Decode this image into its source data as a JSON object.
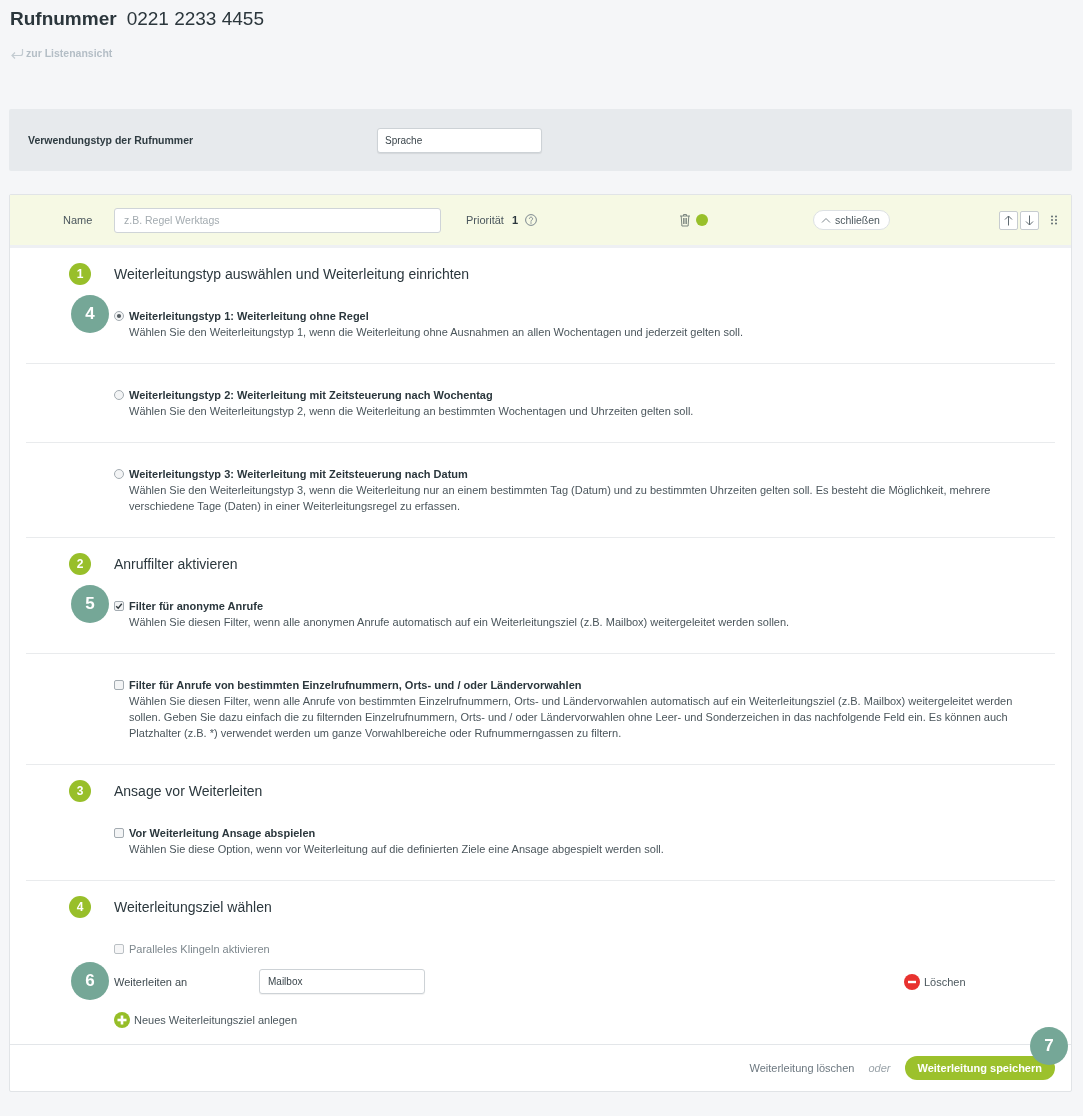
{
  "header": {
    "title": "Rufnummer",
    "number": "0221 2233 4455",
    "back_link": "zur Listenansicht"
  },
  "usage_type": {
    "label": "Verwendungstyp der Rufnummer",
    "value": "Sprache"
  },
  "rule": {
    "name_label": "Name",
    "name_placeholder": "z.B. Regel Werktags",
    "priority_label": "Priorität",
    "priority": "1",
    "active": true,
    "collapse_button": "schließen",
    "sections": [
      {
        "kind": "options",
        "step": "1",
        "title": "Weiterleitungstyp auswählen und Weiterleitung einrichten",
        "options": [
          {
            "kind": "radio",
            "selected": true,
            "title": "Weiterleitungstyp 1: Weiterleitung ohne Regel",
            "description": "Wählen Sie den Weiterleitungstyp 1, wenn die Weiterleitung ohne Ausnahmen an allen Wochentagen und jederzeit gelten soll.",
            "callout": "4"
          },
          {
            "kind": "radio",
            "selected": false,
            "title": "Weiterleitungstyp 2: Weiterleitung mit Zeitsteuerung nach Wochentag",
            "description": "Wählen Sie den Weiterleitungstyp 2, wenn die Weiterleitung an bestimmten Wochentagen und Uhrzeiten gelten soll."
          },
          {
            "kind": "radio",
            "selected": false,
            "title": "Weiterleitungstyp 3: Weiterleitung mit Zeitsteuerung nach Datum",
            "description": "Wählen Sie den Weiterleitungstyp 3, wenn die Weiterleitung nur an einem bestimmten Tag (Datum) und zu bestimmten Uhrzeiten gelten soll. Es besteht die Möglichkeit, mehrere verschiedene Tage (Daten) in einer Weiterleitungsregel zu erfassen."
          }
        ]
      },
      {
        "kind": "options",
        "step": "2",
        "title": "Anruffilter aktivieren",
        "options": [
          {
            "kind": "checkbox",
            "checked": true,
            "title": "Filter für anonyme Anrufe",
            "description": "Wählen Sie diesen Filter, wenn alle anonymen Anrufe automatisch auf ein Weiterleitungsziel (z.B. Mailbox) weitergeleitet werden sollen.",
            "callout": "5"
          },
          {
            "kind": "checkbox",
            "checked": false,
            "title": "Filter für Anrufe von bestimmten Einzelrufnummern, Orts- und / oder Ländervorwahlen",
            "description": "Wählen Sie diesen Filter, wenn alle Anrufe von bestimmten Einzelrufnummern, Orts- und Ländervorwahlen automatisch auf ein Weiterleitungsziel (z.B. Mailbox) weitergeleitet werden sollen. Geben Sie dazu einfach die zu filternden Einzelrufnummern, Orts- und / oder Ländervorwahlen ohne Leer- und Sonderzeichen in das nachfolgende Feld ein. Es können auch Platzhalter (z.B. *) verwendet werden um ganze Vorwahlbereiche oder Rufnummerngassen zu filtern."
          }
        ]
      },
      {
        "kind": "options",
        "step": "3",
        "title": "Ansage vor Weiterleiten",
        "options": [
          {
            "kind": "checkbox",
            "checked": false,
            "title": "Vor Weiterleitung Ansage abspielen",
            "description": "Wählen Sie diese Option, wenn vor Weiterleitung auf die definierten Ziele eine Ansage abgespielt werden soll."
          }
        ]
      },
      {
        "kind": "targets",
        "step": "4",
        "title": "Weiterleitungsziel wählen",
        "parallel_ringing": {
          "label": "Paralleles Klingeln aktivieren",
          "checked": false,
          "disabled": true
        },
        "targets": [
          {
            "label": "Weiterleiten an",
            "value": "Mailbox",
            "delete_button": "Löschen",
            "callout": "6"
          }
        ],
        "add_button": "Neues Weiterleitungsziel anlegen"
      }
    ],
    "footer": {
      "delete_link": "Weiterleitung löschen",
      "separator": "oder",
      "save_button": "Weiterleitung speichern",
      "callout": "7"
    }
  }
}
